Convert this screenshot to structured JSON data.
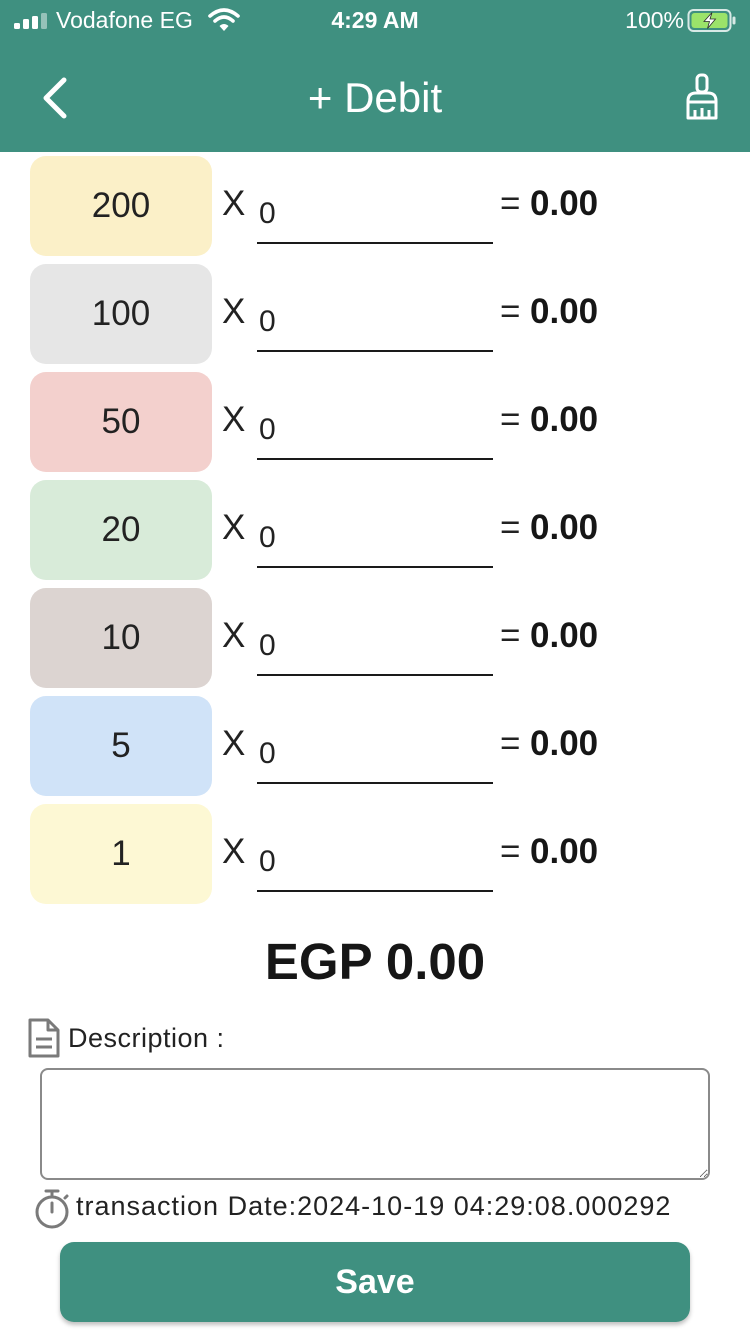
{
  "status_bar": {
    "carrier": "Vodafone EG",
    "time": "4:29 AM",
    "battery": "100%"
  },
  "header": {
    "title": "+ Debit",
    "back_icon": "chevron-left-icon",
    "clear_icon": "broom-icon"
  },
  "colors": {
    "primary": "#3f9080",
    "chip_200": "#fbf0c8",
    "chip_100": "#e6e6e6",
    "chip_50": "#f3d0cd",
    "chip_20": "#d8ebd9",
    "chip_10": "#dcd4d1",
    "chip_5": "#d0e3f8",
    "chip_1": "#fdf8d4"
  },
  "denominations": [
    {
      "label": "200",
      "multiply": "X",
      "count": "0",
      "equals": "=",
      "amount": "0.00"
    },
    {
      "label": "100",
      "multiply": "X",
      "count": "0",
      "equals": "=",
      "amount": "0.00"
    },
    {
      "label": "50",
      "multiply": "X",
      "count": "0",
      "equals": "=",
      "amount": "0.00"
    },
    {
      "label": "20",
      "multiply": "X",
      "count": "0",
      "equals": "=",
      "amount": "0.00"
    },
    {
      "label": "10",
      "multiply": "X",
      "count": "0",
      "equals": "=",
      "amount": "0.00"
    },
    {
      "label": "5",
      "multiply": "X",
      "count": "0",
      "equals": "=",
      "amount": "0.00"
    },
    {
      "label": "1",
      "multiply": "X",
      "count": "0",
      "equals": "=",
      "amount": "0.00"
    }
  ],
  "total": "EGP 0.00",
  "description": {
    "label": "Description :",
    "value": "",
    "icon": "document-icon"
  },
  "transaction": {
    "label": "transaction Date:2024-10-19 04:29:08.000292",
    "icon": "timer-icon"
  },
  "save_label": "Save"
}
